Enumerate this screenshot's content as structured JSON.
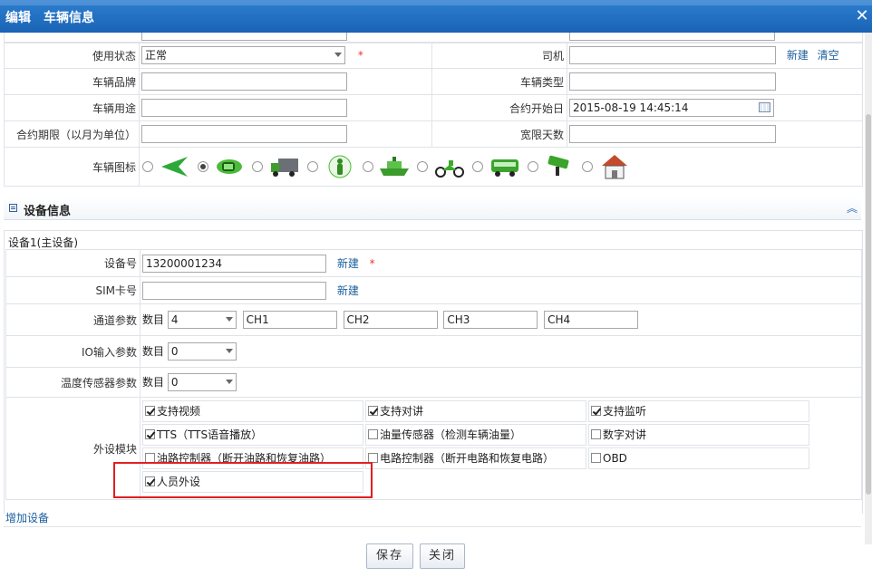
{
  "window": {
    "title": "编辑　车辆信息",
    "close": "✕"
  },
  "vehicle": {
    "status_label": "使用状态",
    "status_value": "正常",
    "required": "*",
    "driver_label": "司机",
    "driver_new": "新建",
    "driver_clear": "清空",
    "brand_label": "车辆品牌",
    "type_label": "车辆类型",
    "usage_label": "车辆用途",
    "contract_start_label": "合约开始日",
    "contract_start_value": "2015-08-19 14:45:14",
    "contract_term_label": "合约期限（以月为单位）",
    "grace_label": "宽限天数",
    "icon_label": "车辆图标",
    "icons": [
      "arrow-icon",
      "car-icon",
      "truck-icon",
      "person-icon",
      "ship-icon",
      "motorcycle-icon",
      "bus-icon",
      "camera-icon",
      "house-icon"
    ],
    "selected_icon": "car-icon"
  },
  "device_section": {
    "title": "设备信息",
    "device_group": "设备1(主设备)",
    "device_no_label": "设备号",
    "device_no_value": "13200001234",
    "device_new": "新建",
    "required": "*",
    "sim_label": "SIM卡号",
    "sim_new": "新建",
    "channel_label": "通道参数",
    "count_label": "数目",
    "channel_count": "4",
    "channels": [
      "CH1",
      "CH2",
      "CH3",
      "CH4"
    ],
    "io_label": "IO输入参数",
    "io_count": "0",
    "temp_label": "温度传感器参数",
    "temp_count": "0",
    "peripheral_label": "外设模块",
    "peripherals": [
      {
        "label": "支持视频",
        "checked": true
      },
      {
        "label": "支持对讲",
        "checked": true
      },
      {
        "label": "支持监听",
        "checked": true
      },
      {
        "label": "TTS（TTS语音播放）",
        "checked": true
      },
      {
        "label": "油量传感器（检测车辆油量）",
        "checked": false
      },
      {
        "label": "数字对讲",
        "checked": false
      },
      {
        "label": "油路控制器（断开油路和恢复油路）",
        "checked": false
      },
      {
        "label": "电路控制器（断开电路和恢复电路）",
        "checked": false
      },
      {
        "label": "OBD",
        "checked": false
      },
      {
        "label": "人员外设",
        "checked": true
      }
    ],
    "add_device": "增加设备"
  },
  "footer": {
    "save": "保存",
    "close": "关闭"
  },
  "colors": {
    "titlebar": "#1a63b5",
    "link": "#1a5f9e",
    "highlight": "#e02020"
  }
}
